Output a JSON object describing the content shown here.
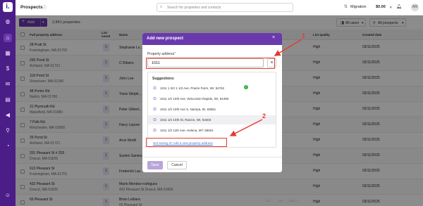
{
  "topbar": {
    "title": "Prospects",
    "search_placeholder": "Search for properties and contacts",
    "migration": "Migration",
    "balance": "$0.00",
    "avatar": "AM"
  },
  "toolbar": {
    "add_label": "Add",
    "count": "2,841 properties",
    "all_users": "All users",
    "all_prospects": "All prospects"
  },
  "table": {
    "headers": {
      "address": "Full property address",
      "list_count": "List count",
      "name": "Name",
      "list_quality": "List quality",
      "created": "Created date"
    },
    "rows": [
      {
        "street": "28 Pratt St",
        "city": "Framingham, MA 01702",
        "count": "1",
        "name": "Stephanie Lo...",
        "quality": "High",
        "date": "03/11/2025"
      },
      {
        "street": "255 Pond St",
        "city": "Ashland, MA 01721",
        "count": "1",
        "name": "C Ribeiro",
        "quality": "High",
        "date": "03/11/2025"
      },
      {
        "street": "118 Pond St",
        "city": "Stoneham, MA 02180",
        "count": "1",
        "name": "John Lee",
        "quality": "High",
        "date": "03/11/2025"
      },
      {
        "street": "48 Porter Rd",
        "city": "Natick, MA 01760",
        "count": "1",
        "name": "Yanis Skripti...",
        "quality": "High",
        "date": "03/11/2025"
      },
      {
        "street": "31 Plymouth Rd",
        "city": "Wakefield, MA 01880",
        "count": "1",
        "name": "Peter Gilbert...",
        "quality": "High",
        "date": "03/11/2025"
      },
      {
        "street": "7 Polk Rd",
        "city": "Winchester, MA 01890",
        "count": "1",
        "name": "Harry Lepore",
        "quality": "High",
        "date": "03/11/2025"
      },
      {
        "street": "25 Pond St",
        "city": "Ashland, MA 01721",
        "count": "1",
        "name": "Arun Modh",
        "quality": "High",
        "date": "03/11/2025"
      },
      {
        "street": "201 Pleasant St # 203",
        "city": "Dracut, MA 01826",
        "count": "1",
        "name": "Suelen Santos",
        "quality": "High",
        "date": "03/11/2025"
      },
      {
        "street": "613 Pleasant St",
        "city": "Framingham, MA 01701",
        "count": "1",
        "name": "Frederick Lav...",
        "quality": "High",
        "date": "03/11/2025"
      },
      {
        "street": "432 Pleasant St",
        "city": "Dracut, MA 01826",
        "count": "1",
        "name": "Mario Mendez-rodriguez",
        "city2": "432 Pleasant St Dracut, MA 01826",
        "quality": "High",
        "date": "03/11/2025"
      },
      {
        "street": "65 Pleasant St",
        "city": "",
        "count": "1",
        "name": "Brian Leblanc",
        "city2": "65 Pleasant St",
        "quality": "High",
        "date": "03/11/2025"
      }
    ]
  },
  "modal": {
    "title": "Add new prospect",
    "label": "Property address",
    "required_mark": "*",
    "input_value": "1011",
    "suggestions_title": "Suggestions:",
    "suggestions": [
      "1011 1 3/4 1 1/2 Ave, Prairie Farm, WI, 54762",
      "1011 1/2 10th Ave, Wisconsin Rapids, WI, 54495",
      "1011 1/2 10th Ave S, Nampa, ID, 83651",
      "1011 1/2 10th St, Racine, WI, 53403",
      "1011 1/2 11th Ave, Helena, MT, 59601"
    ],
    "not_seeing": "Not seeing it? Add a new property address",
    "save": "Save",
    "cancel": "Cancel"
  },
  "annotations": {
    "one": "1",
    "two": "2"
  },
  "pager": [
    "117",
    "118",
    "Next »"
  ],
  "colors": {
    "brand": "#4b1d86",
    "accent": "#6a3aad",
    "annotation": "#e53935"
  }
}
